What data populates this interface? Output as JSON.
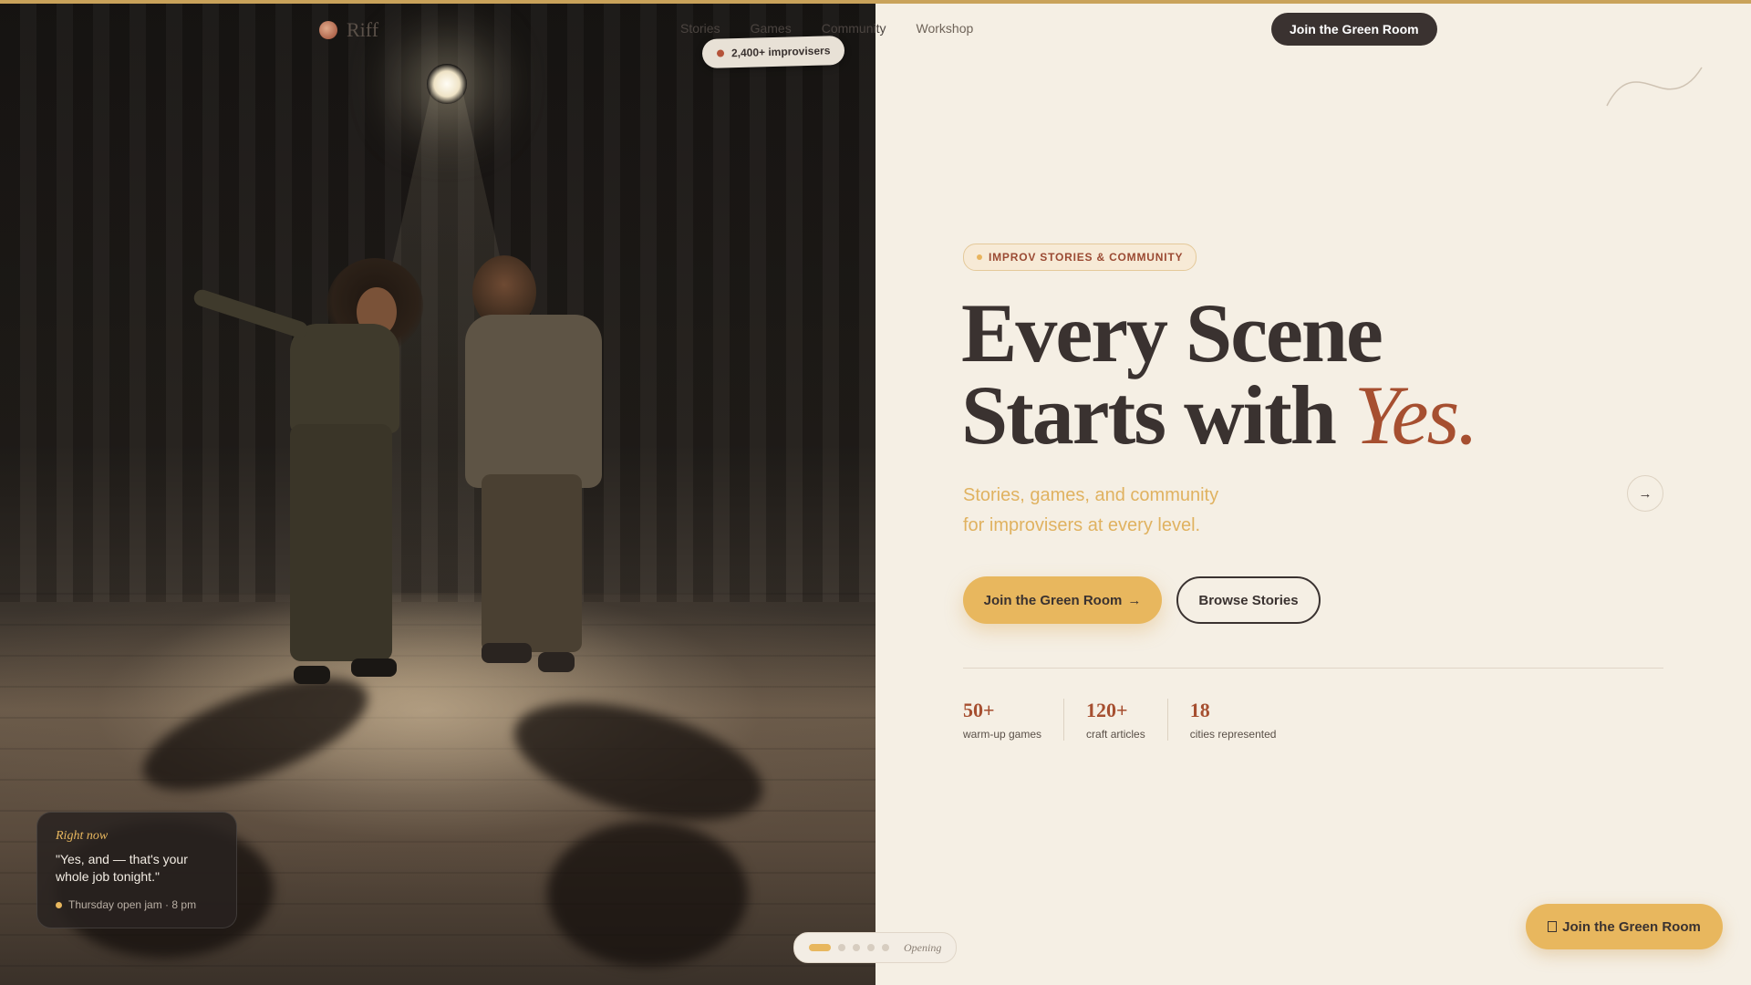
{
  "brand": {
    "name": "Riff"
  },
  "nav": {
    "items": [
      "Stories",
      "Games",
      "Community",
      "Workshop"
    ],
    "cta": "Join the Green Room"
  },
  "members_pill": "2,400+ improvisers",
  "hero": {
    "badge": "IMPROV STORIES & COMMUNITY",
    "title_line1": "Every Scene",
    "title_line2": "Starts with",
    "title_accent": "Yes.",
    "subtitle_line1": "Stories, games, and community",
    "subtitle_line2": "for improvisers at every level.",
    "primary_cta": "Join the Green Room",
    "primary_cta_arrow": "→",
    "secondary_cta": "Browse Stories",
    "next_arrow": "→"
  },
  "stats": [
    {
      "value": "50+",
      "label": "warm-up games"
    },
    {
      "value": "120+",
      "label": "craft articles"
    },
    {
      "value": "18",
      "label": "cities represented"
    }
  ],
  "quote_card": {
    "eyebrow": "Right now",
    "quote": "\"Yes, and — that's your whole job tonight.\"",
    "meta": "Thursday open jam · 8 pm"
  },
  "slider": {
    "label": "Opening",
    "count": 5,
    "active": 1
  },
  "floating_cta": "Join the Green Room",
  "colors": {
    "accent": "#e8b75e",
    "rust": "#a64f30",
    "ink": "#3a3230",
    "cream": "#f5efe4"
  }
}
